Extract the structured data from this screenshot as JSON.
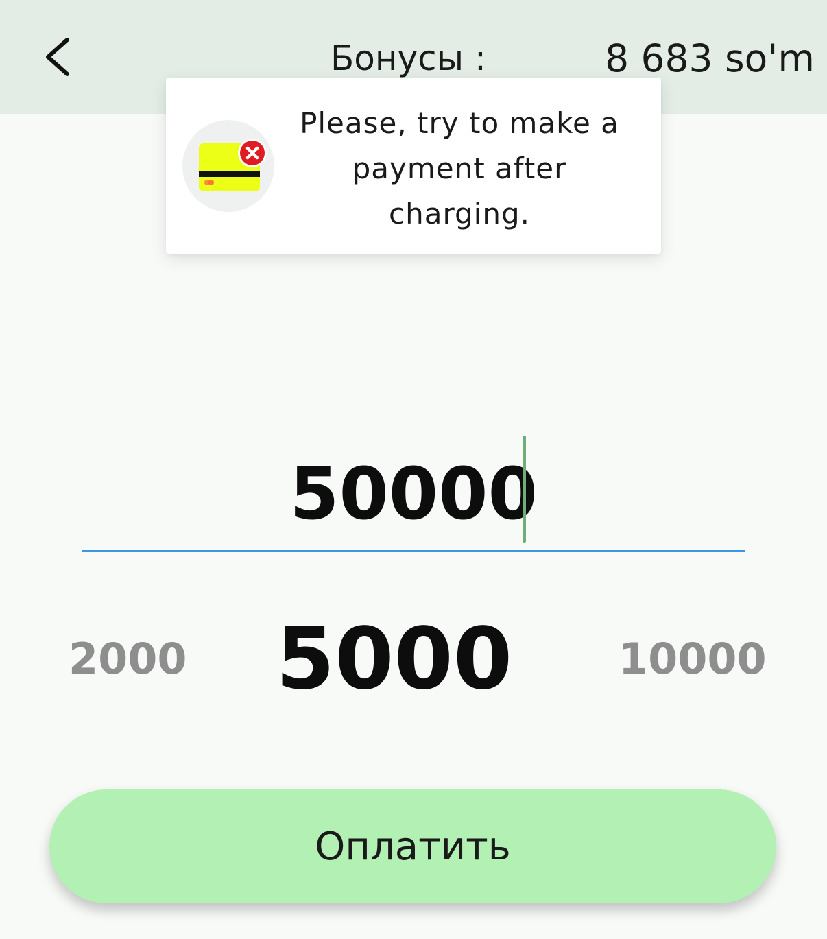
{
  "header": {
    "back_icon": "chevron-left-icon",
    "bonus_label": "Бонусы :",
    "bonus_value": "8 683 so'm",
    "background": "#e3ede5"
  },
  "toast": {
    "icon": "card-error-icon",
    "message": "Please, try to make a payment after charging."
  },
  "amount_input": {
    "value": "50000",
    "underline_color": "#3d97e0",
    "cursor_color": "#6fae79"
  },
  "presets": {
    "left": "2000",
    "center": "5000",
    "right": "10000"
  },
  "pay_button": {
    "label": "Оплатить",
    "color": "#b3f0b3"
  }
}
